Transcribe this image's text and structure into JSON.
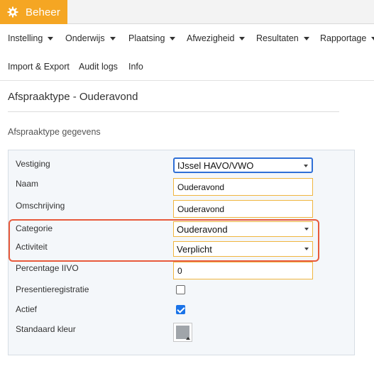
{
  "app": {
    "title": "Beheer",
    "icon": "gear-icon",
    "accent_color": "#f5a623"
  },
  "nav": {
    "row1": [
      {
        "label": "Instelling",
        "dropdown": true
      },
      {
        "label": "Onderwijs",
        "dropdown": true
      },
      {
        "label": "Plaatsing",
        "dropdown": true
      },
      {
        "label": "Afwezigheid",
        "dropdown": true
      },
      {
        "label": "Resultaten",
        "dropdown": true
      },
      {
        "label": "Rapportage",
        "dropdown": true
      }
    ],
    "row2": [
      {
        "label": "Import & Export"
      },
      {
        "label": "Audit logs"
      },
      {
        "label": "Info"
      }
    ]
  },
  "page": {
    "title": "Afspraaktype - Ouderavond",
    "section_title": "Afspraaktype gegevens"
  },
  "form": {
    "vestiging": {
      "label": "Vestiging",
      "value": "IJssel HAVO/VWO"
    },
    "naam": {
      "label": "Naam",
      "value": "Ouderavond"
    },
    "omschrijving": {
      "label": "Omschrijving",
      "value": "Ouderavond"
    },
    "categorie": {
      "label": "Categorie",
      "value": "Ouderavond"
    },
    "activiteit": {
      "label": "Activiteit",
      "value": "Verplicht"
    },
    "percentage_iivo": {
      "label": "Percentage IIVO",
      "value": "0"
    },
    "presentieregistratie": {
      "label": "Presentieregistratie",
      "checked": false
    },
    "actief": {
      "label": "Actief",
      "checked": true
    },
    "standaard_kleur": {
      "label": "Standaard kleur",
      "color": "#a0a5aa"
    }
  },
  "highlight_color": "#e85a3c"
}
